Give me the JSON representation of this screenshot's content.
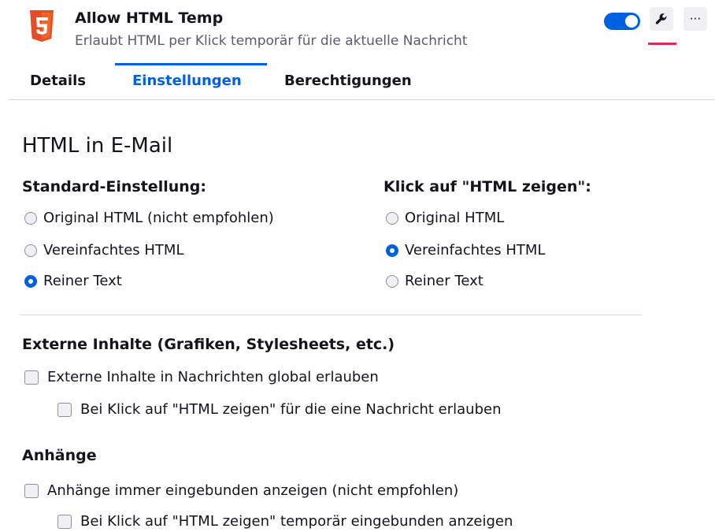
{
  "addon": {
    "name": "Allow HTML Temp",
    "description": "Erlaubt HTML per Klick temporär für die aktuelle Nachricht",
    "enabled": true,
    "more_label": "···"
  },
  "tabs": [
    {
      "label": "Details",
      "active": false
    },
    {
      "label": "Einstellungen",
      "active": true
    },
    {
      "label": "Berechtigungen",
      "active": false
    }
  ],
  "section": {
    "title": "HTML in E-Mail"
  },
  "default_setting": {
    "heading": "Standard-Einstellung:",
    "options": [
      {
        "label": "Original HTML (nicht empfohlen)",
        "checked": false
      },
      {
        "label": "Vereinfachtes HTML",
        "checked": false
      },
      {
        "label": "Reiner Text",
        "checked": true
      }
    ]
  },
  "click_setting": {
    "heading": "Klick auf \"HTML zeigen\":",
    "options": [
      {
        "label": "Original HTML",
        "checked": false
      },
      {
        "label": "Vereinfachtes HTML",
        "checked": true
      },
      {
        "label": "Reiner Text",
        "checked": false
      }
    ]
  },
  "external": {
    "heading": "Externe Inhalte (Grafiken, Stylesheets, etc.)",
    "global_label": "Externe Inhalte in Nachrichten global erlauben",
    "global_checked": false,
    "onclick_label": "Bei Klick auf \"HTML zeigen\" für die eine Nachricht erlauben",
    "onclick_checked": false
  },
  "attachments": {
    "heading": "Anhänge",
    "always_label": "Anhänge immer eingebunden anzeigen (nicht empfohlen)",
    "always_checked": false,
    "onclick_label": "Bei Klick auf \"HTML zeigen\" temporär eingebunden anzeigen",
    "onclick_checked": false
  },
  "colors": {
    "accent": "#0060df",
    "html5_orange": "#e44d26",
    "prefs_indicator": "#e22850"
  },
  "icons": {
    "addon": "html5-icon",
    "prefs": "wrench-icon",
    "more": "more-icon"
  }
}
